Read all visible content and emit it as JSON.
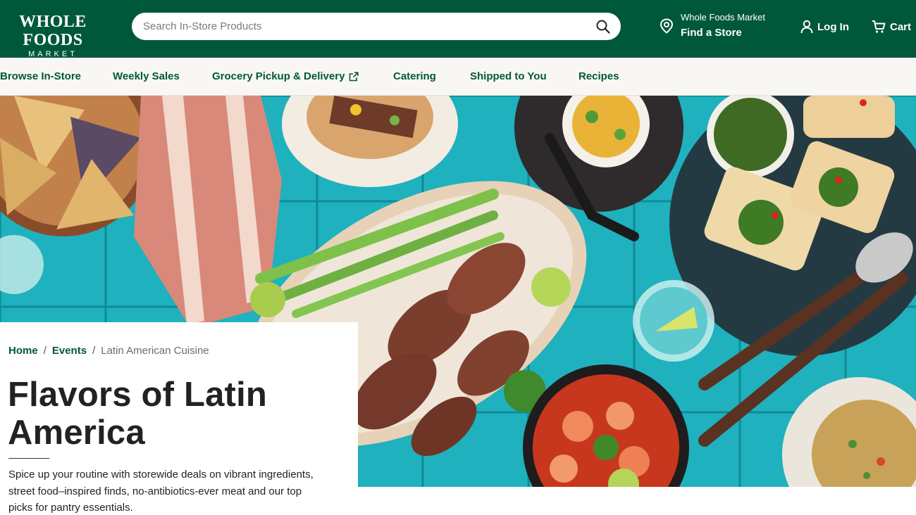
{
  "header": {
    "logo_line1": "WHOLE FOODS",
    "logo_line2": "MARKET",
    "search_placeholder": "Search In-Store Products",
    "store_name": "Whole Foods Market",
    "find_store_label": "Find a Store",
    "login_label": "Log In",
    "cart_label": "Cart"
  },
  "nav": {
    "items": [
      {
        "label": "Browse In-Store"
      },
      {
        "label": "Weekly Sales"
      },
      {
        "label": "Grocery Pickup & Delivery",
        "icon": "external-link-icon"
      },
      {
        "label": "Catering"
      },
      {
        "label": "Shipped to You"
      },
      {
        "label": "Recipes"
      }
    ]
  },
  "breadcrumb": {
    "home": "Home",
    "events": "Events",
    "current": "Latin American Cuisine",
    "separator": "/"
  },
  "page": {
    "title": "Flavors of Latin America",
    "description": "Spice up your routine with storewide deals on vibrant ingredients, street food–inspired finds, no-antibiotics-ever meat and our top picks for pantry essentials."
  },
  "colors": {
    "brand_green": "#00583a",
    "nav_background": "#f8f7f4",
    "hero_tile": "#23b0bc"
  },
  "icons": {
    "search": "search-icon",
    "location": "location-pin-icon",
    "user": "user-icon",
    "cart": "cart-icon",
    "external": "external-link-icon"
  }
}
